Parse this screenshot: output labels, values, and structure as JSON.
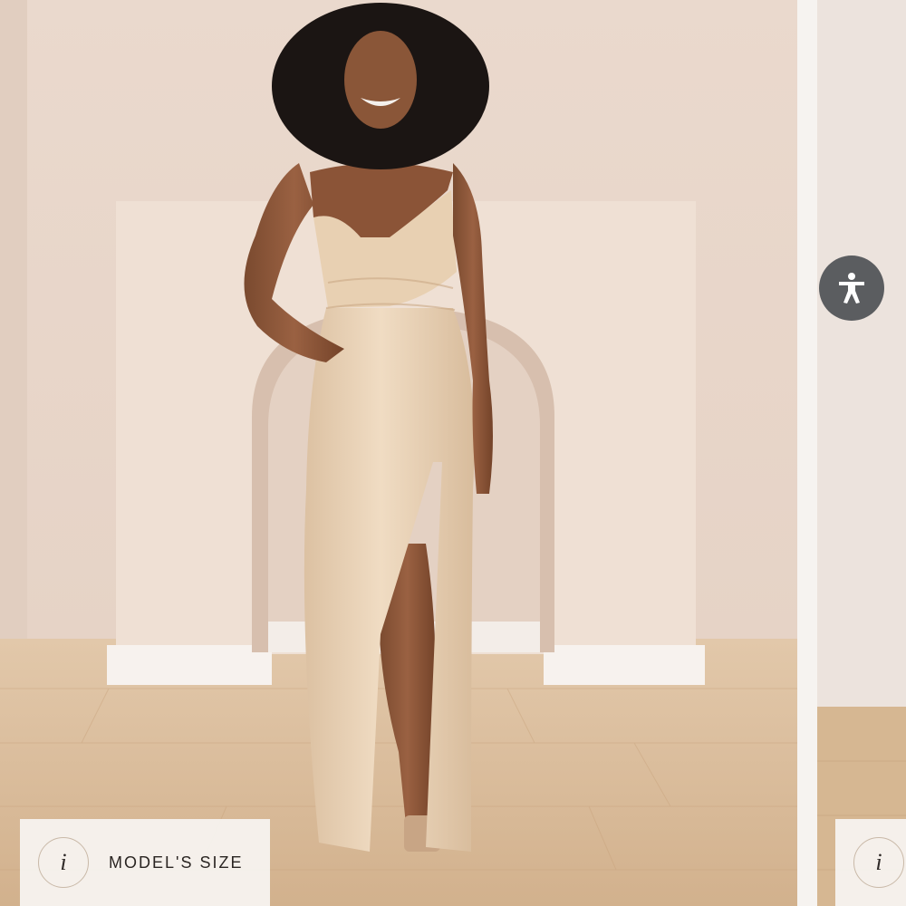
{
  "gallery": {
    "main_image": {
      "alt_semantic": "product-photo",
      "info_chip": {
        "icon": "info-icon",
        "icon_glyph": "i",
        "label": "MODEL'S SIZE"
      }
    },
    "next_image": {
      "info_chip": {
        "icon": "info-icon",
        "icon_glyph": "i"
      }
    }
  },
  "accessibility": {
    "icon": "accessibility-icon"
  },
  "colors": {
    "wall": "#ebdcd1",
    "floor": "#d9b995",
    "dress": "#e9d2b6",
    "chip_bg": "#f6f2ee",
    "a11y_bg": "#5b5d60"
  }
}
